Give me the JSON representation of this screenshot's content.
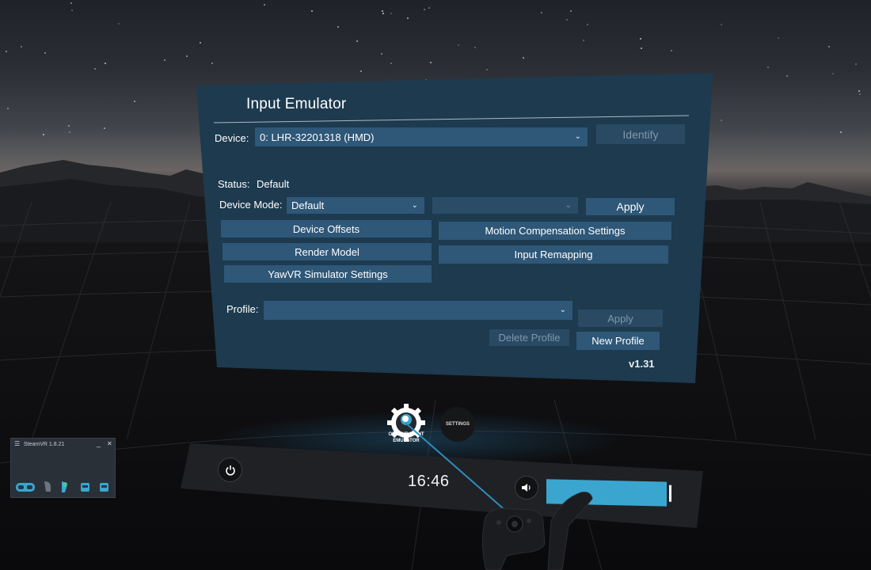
{
  "panel": {
    "title": "Input Emulator",
    "device_label": "Device:",
    "device_value": "0: LHR-32201318 (HMD)",
    "identify_button": "Identify",
    "status_label": "Status:",
    "status_value": "Default",
    "device_mode_label": "Device Mode:",
    "device_mode_value": "Default",
    "device_mode_secondary_value": "",
    "apply_button": "Apply",
    "device_offsets_button": "Device Offsets",
    "motion_compensation_button": "Motion Compensation Settings",
    "render_model_button": "Render Model",
    "input_remapping_button": "Input Remapping",
    "yawvr_button": "YawVR Simulator Settings",
    "profile_label": "Profile:",
    "profile_value": "",
    "profile_apply_button": "Apply",
    "delete_profile_button": "Delete Profile",
    "new_profile_button": "New Profile",
    "version": "v1.31"
  },
  "dashboard": {
    "clock": "16:46",
    "volume_level": 0.97,
    "app_label_line1": "OPENVR INPUT",
    "app_label_line2": "EMULATOR",
    "settings_label": "SETTINGS"
  },
  "mini_window": {
    "title": "SteamVR 1.8.21",
    "menu_icon": "hamburger-icon",
    "minimize_label": "_",
    "close_label": "✕",
    "status_icons": [
      "headset-icon",
      "base-station-icon",
      "controller-icon",
      "tracker-icon",
      "tracker-icon"
    ]
  },
  "colors": {
    "panel_bg": "#1d3a4f",
    "button_bg": "#2e5778",
    "accent": "#3aa6cf"
  }
}
